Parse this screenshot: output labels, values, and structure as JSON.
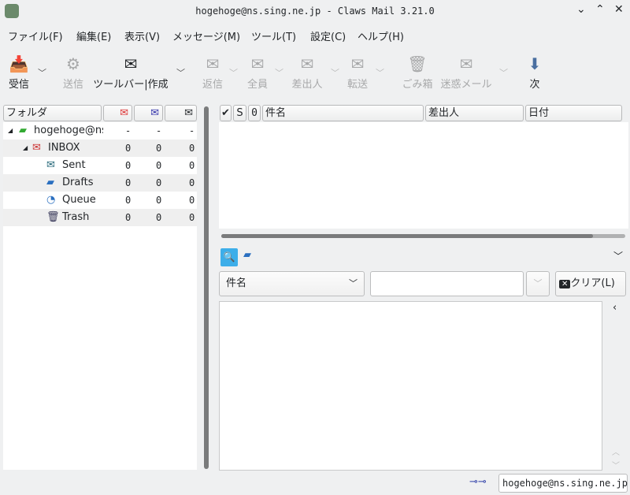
{
  "window": {
    "title": "hogehoge@ns.sing.ne.jp - Claws Mail 3.21.0"
  },
  "menu": [
    "ファイル(F)",
    "編集(E)",
    "表示(V)",
    "メッセージ(M)",
    "ツール(T)",
    "設定(C)",
    "ヘルプ(H)"
  ],
  "toolbar": [
    {
      "label": "受信",
      "icon": "receive-icon",
      "enabled": true
    },
    {
      "label": "送信",
      "icon": "send-icon",
      "enabled": false
    },
    {
      "label": "ツールバー|作成",
      "icon": "compose-icon",
      "enabled": true
    },
    {
      "label": "返信",
      "icon": "reply-icon",
      "enabled": false
    },
    {
      "label": "全員",
      "icon": "reply-all-icon",
      "enabled": false
    },
    {
      "label": "差出人",
      "icon": "reply-sender-icon",
      "enabled": false
    },
    {
      "label": "転送",
      "icon": "forward-icon",
      "enabled": false
    },
    {
      "label": "ごみ箱",
      "icon": "trash-icon",
      "enabled": false
    },
    {
      "label": "迷惑メール",
      "icon": "spam-icon",
      "enabled": false
    },
    {
      "label": "次",
      "icon": "next-arrow-icon",
      "enabled": true
    }
  ],
  "folders": {
    "header": "フォルダ",
    "rows": [
      {
        "name": "hogehoge@ns",
        "new": "-",
        "unread": "-",
        "total": "-"
      },
      {
        "name": "INBOX",
        "new": "0",
        "unread": "0",
        "total": "0"
      },
      {
        "name": "Sent",
        "new": "0",
        "unread": "0",
        "total": "0"
      },
      {
        "name": "Drafts",
        "new": "0",
        "unread": "0",
        "total": "0"
      },
      {
        "name": "Queue",
        "new": "0",
        "unread": "0",
        "total": "0"
      },
      {
        "name": "Trash",
        "new": "0",
        "unread": "0",
        "total": "0"
      }
    ]
  },
  "messages": {
    "columns": [
      "✔",
      "S",
      "0",
      "件名",
      "差出人",
      "日付"
    ],
    "scroll_fraction": 0.92
  },
  "search": {
    "field": "件名",
    "value": "",
    "clear_label": "クリア(L)"
  },
  "status": {
    "account": "hogehoge@ns.sing.ne.jp"
  }
}
